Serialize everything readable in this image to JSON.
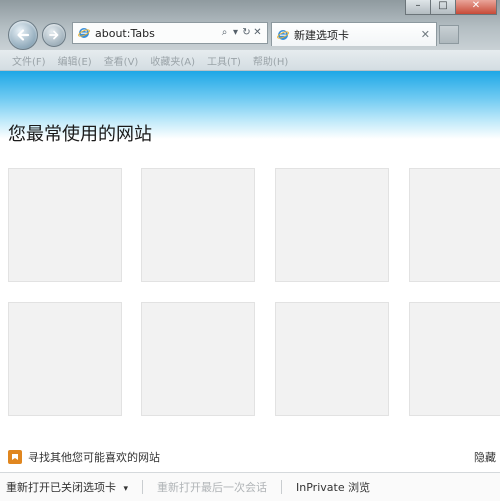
{
  "window": {
    "minimize_glyph": "–",
    "maximize_glyph": "□",
    "close_glyph": "✕"
  },
  "navigation": {
    "back_icon": "back-arrow-icon",
    "forward_icon": "forward-arrow-icon"
  },
  "address_bar": {
    "value": "about:Tabs",
    "search_glyph": "⌕",
    "dropdown_glyph": "▾",
    "refresh_glyph": "↻",
    "stop_glyph": "✕"
  },
  "tab": {
    "title": "新建选项卡",
    "close_glyph": "✕"
  },
  "menu": [
    {
      "label": "文件(F)"
    },
    {
      "label": "编辑(E)"
    },
    {
      "label": "查看(V)"
    },
    {
      "label": "收藏夹(A)"
    },
    {
      "label": "工具(T)"
    },
    {
      "label": "帮助(H)"
    }
  ],
  "content": {
    "heading": "您最常使用的网站",
    "tile_rows": 2,
    "tiles_per_row": 4
  },
  "footer": {
    "discover_link": "寻找其他您可能喜欢的网站",
    "hide_link": "隐藏",
    "reopen_closed_tabs": "重新打开已关闭选项卡",
    "reopen_closed_tabs_arrow": "▾",
    "reopen_last_session": "重新打开最后一次会话",
    "inprivate": "InPrivate 浏览"
  },
  "colors": {
    "banner_top": "#1ea7e6",
    "chrome_gray": "#b4bec3",
    "tile_fill": "#f2f2f2",
    "suggest_icon": "#e0861f"
  }
}
